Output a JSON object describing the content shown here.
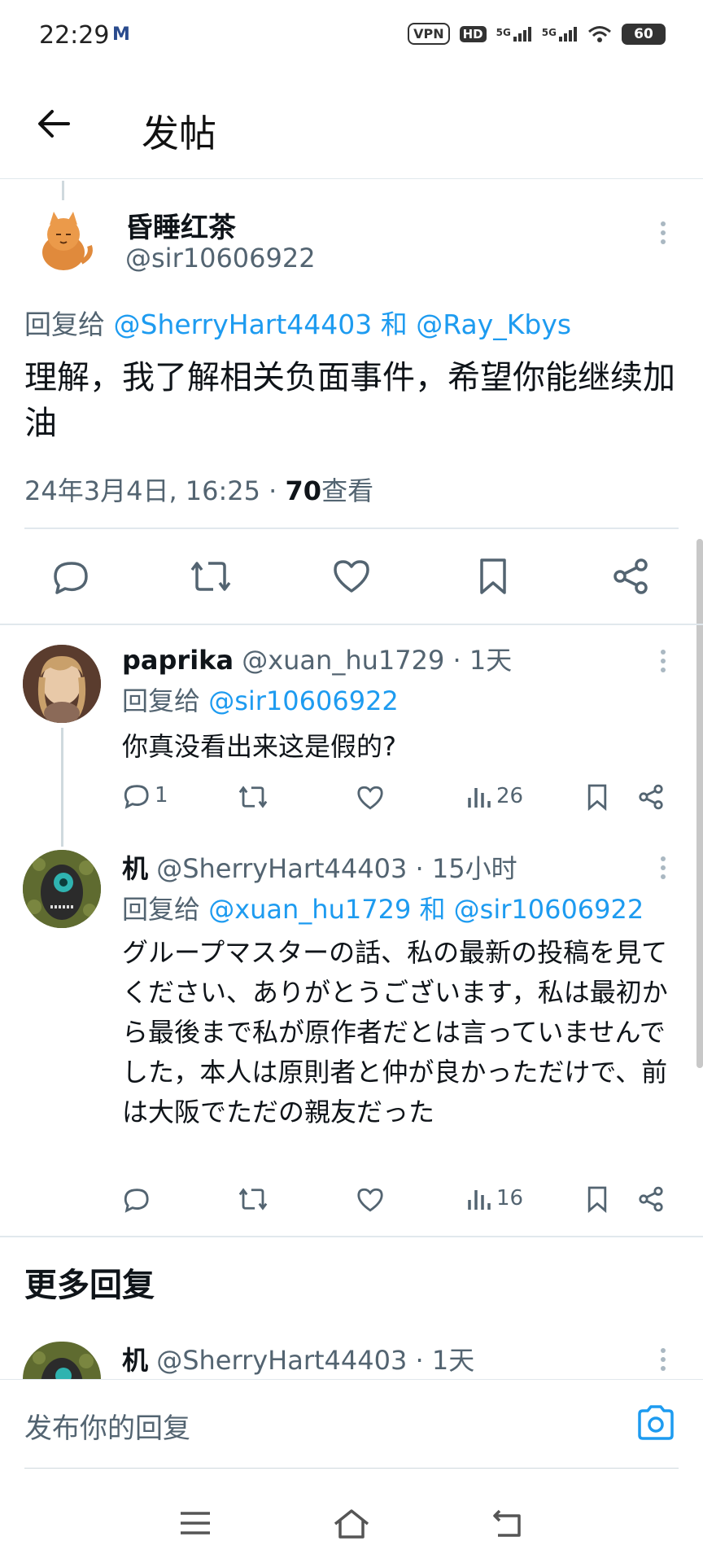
{
  "status": {
    "time": "22:29",
    "mail_icon": "M",
    "vpn": "VPN",
    "hd": "HD",
    "net1": "5G",
    "net2": "5G",
    "battery": "60"
  },
  "header": {
    "title": "发帖"
  },
  "main_post": {
    "name": "昏睡红茶",
    "handle": "@sir10606922",
    "reply_prefix": "回复给",
    "mention1": "@SherryHart44403",
    "and": "和",
    "mention2": "@Ray_Kbys",
    "text": "理解，我了解相关负面事件，希望你能继续加油",
    "date": "24年3月4日, 16:25 ·",
    "views_count": "70",
    "views_label": "查看"
  },
  "replies": [
    {
      "name": "paprika",
      "handle": "@xuan_hu1729 · 1天",
      "reply_prefix": "回复给",
      "mentions": "@sir10606922",
      "text": "你真没看出来这是假的?",
      "comments": "1",
      "views": "26"
    },
    {
      "name": "机",
      "handle": "@SherryHart44403 · 15小时",
      "reply_prefix": "回复给",
      "mentions": "@xuan_hu1729 和 @sir10606922",
      "text": "グループマスターの話、私の最新の投稿を見てください、ありがとうございます，私は最初から最後まで私が原作者だとは言っていませんでした，本人は原則者と仲が良かっただけで、前は大阪でただの親友だった",
      "comments": "",
      "views": "16"
    }
  ],
  "more_replies": {
    "title": "更多回复",
    "first": {
      "name": "机",
      "handle": "@SherryHart44403 · 1天"
    }
  },
  "reply_bar": {
    "placeholder": "发布你的回复"
  }
}
